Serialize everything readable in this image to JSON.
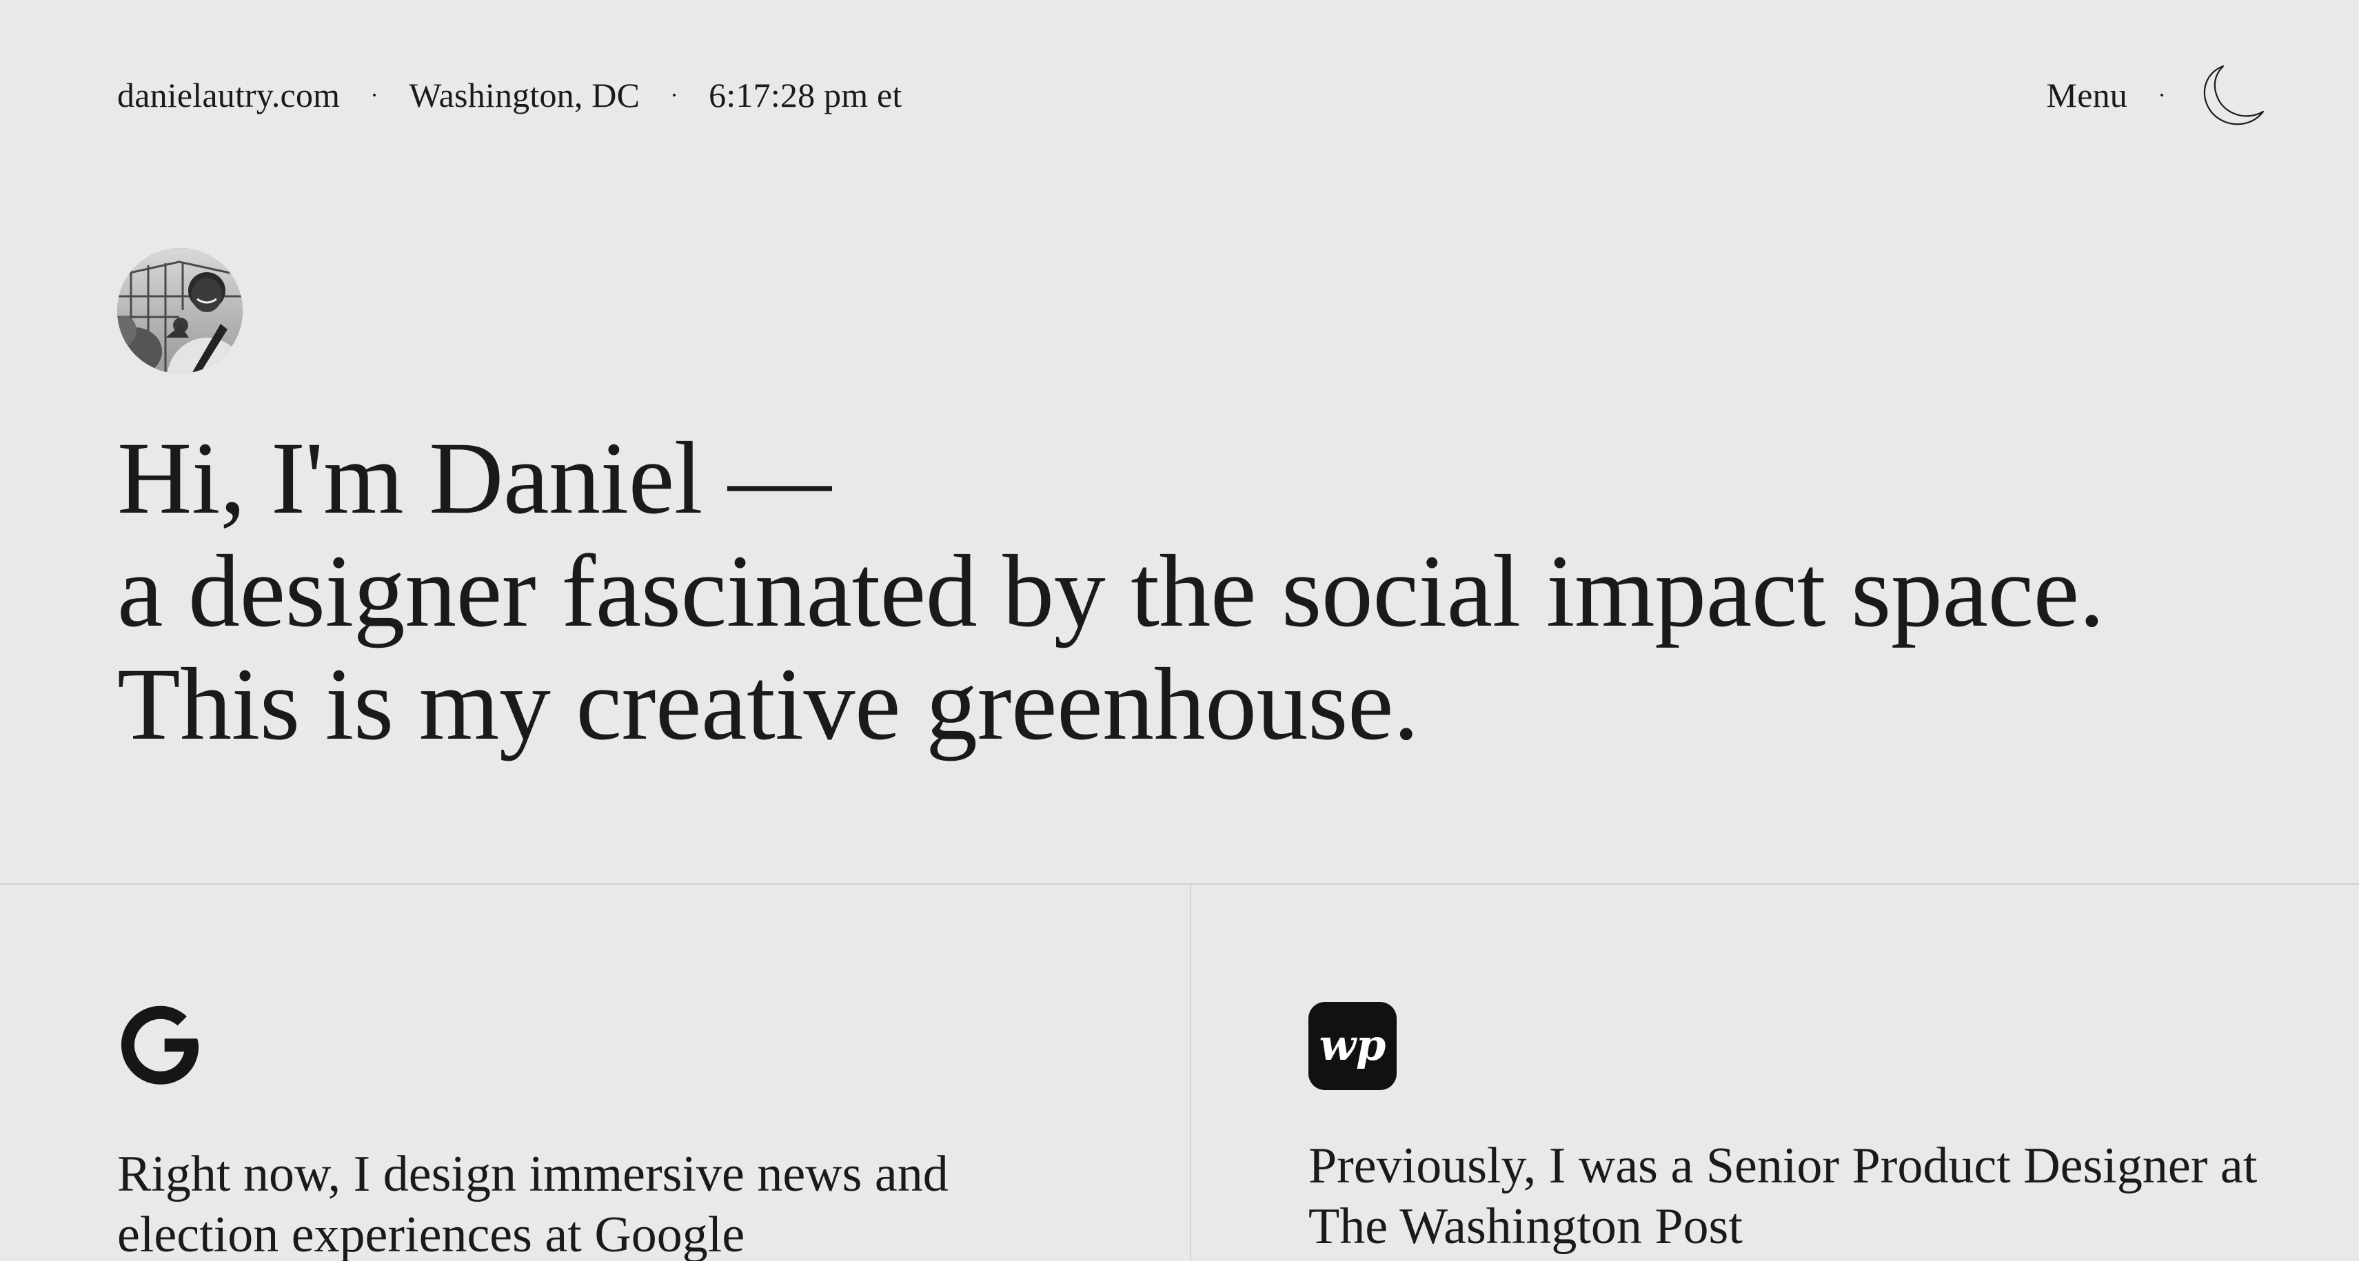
{
  "nav": {
    "site": "danielautry.com",
    "location": "Washington, DC",
    "time": "6:17:28 pm et",
    "menu_label": "Menu",
    "theme_icon": "moon-icon"
  },
  "hero": {
    "line1": "Hi, I'm Daniel —",
    "line2": "a designer fascinated by the social impact space.",
    "line3": "This is my creative greenhouse."
  },
  "cards": [
    {
      "icon": "google-logo-icon",
      "text": "Right now, I design immersive news and election experiences at Google"
    },
    {
      "icon": "washington-post-logo-icon",
      "text": "Previously, I was a Senior Product Designer at The Washington Post"
    }
  ]
}
